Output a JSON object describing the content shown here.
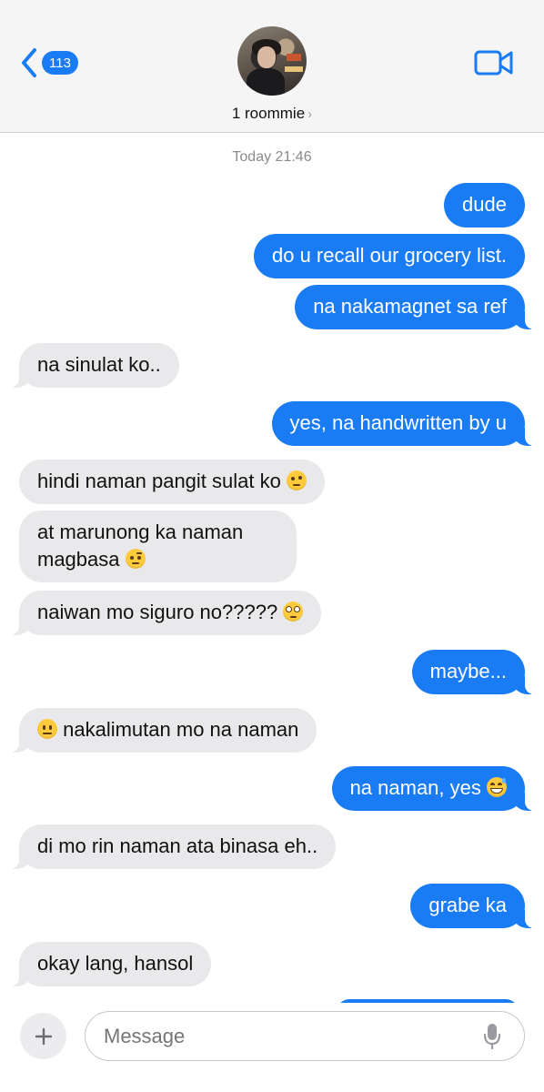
{
  "header": {
    "back_badge": "113",
    "contact_name": "1 roommie",
    "contact_chevron": "›",
    "icons": {
      "back": "chevron-left-icon",
      "video": "video-camera-icon"
    }
  },
  "timestamp": "Today 21:46",
  "messages": [
    {
      "side": "sent",
      "text": "dude"
    },
    {
      "side": "sent",
      "text": "do u recall our grocery list."
    },
    {
      "side": "sent",
      "text": "na nakamagnet sa ref"
    },
    {
      "side": "received",
      "text": "na sinulat ko.."
    },
    {
      "side": "sent",
      "text": "yes, na handwritten by u"
    },
    {
      "side": "received",
      "text": "hindi naman pangit sulat ko",
      "emoji": "thinking-face"
    },
    {
      "side": "received",
      "text_line1": "at marunong ka naman",
      "text_line2": "magbasa",
      "emoji": "raised-eyebrow-face"
    },
    {
      "side": "received",
      "text": "naiwan mo siguro no?????",
      "emoji": "eye-roll-face"
    },
    {
      "side": "sent",
      "text": "maybe..."
    },
    {
      "side": "received",
      "text": "nakalimutan mo na naman",
      "emoji_before": "neutral-face"
    },
    {
      "side": "sent",
      "text": "na naman, yes",
      "emoji": "grinning-sweat-face"
    },
    {
      "side": "received",
      "text": "di mo rin naman ata binasa eh.."
    },
    {
      "side": "sent",
      "text": "grabe ka"
    },
    {
      "side": "received",
      "text": "okay lang, hansol"
    }
  ],
  "composer": {
    "placeholder": "Message",
    "icons": {
      "add": "plus-icon",
      "mic": "microphone-icon"
    }
  },
  "colors": {
    "sent_bubble": "#1a7cf5",
    "received_bubble": "#e9e9eb",
    "accent": "#1a7cf5",
    "header_bg": "#f5f5f5"
  }
}
